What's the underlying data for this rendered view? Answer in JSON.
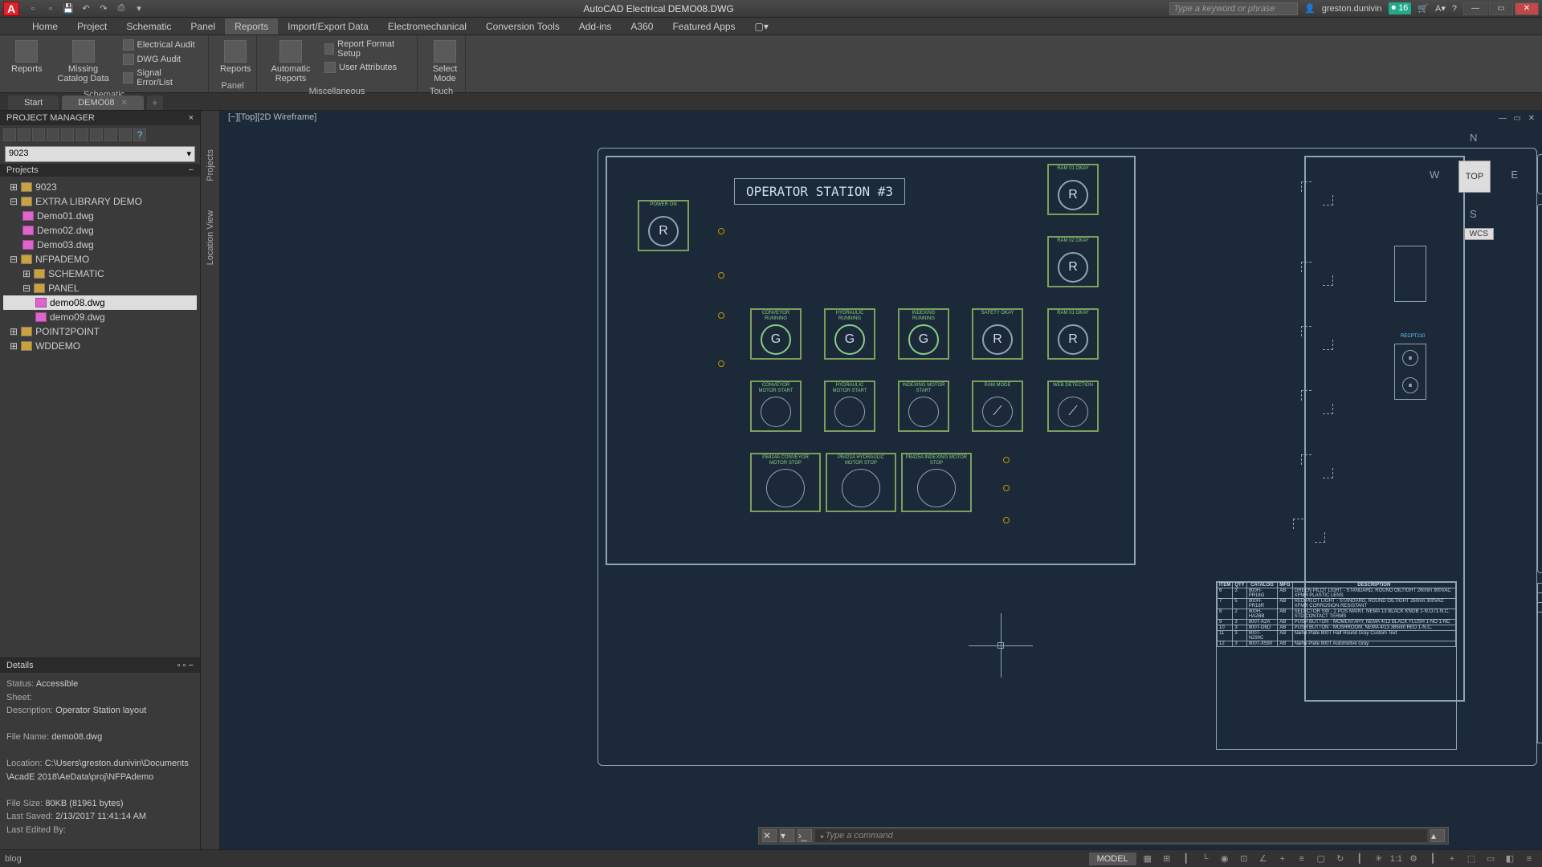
{
  "title": "AutoCAD Electrical   DEMO08.DWG",
  "search_placeholder": "Type a keyword or phrase",
  "user": "greston.dunivin",
  "info_badge": "16",
  "menu": [
    "Home",
    "Project",
    "Schematic",
    "Panel",
    "Reports",
    "Import/Export Data",
    "Electromechanical",
    "Conversion Tools",
    "Add-ins",
    "A360",
    "Featured Apps"
  ],
  "active_menu": "Reports",
  "ribbon": {
    "schematic": {
      "title": "Schematic",
      "reports": "Reports",
      "missing": "Missing Catalog Data",
      "audit": "Electrical Audit",
      "dwg_audit": "DWG Audit",
      "signal": "Signal Error/List"
    },
    "panel": {
      "title": "Panel",
      "reports": "Reports"
    },
    "misc": {
      "title": "Miscellaneous",
      "auto": "Automatic Reports",
      "format": "Report Format Setup",
      "user_attr": "User Attributes"
    },
    "touch": {
      "title": "Touch",
      "select": "Select Mode"
    }
  },
  "tabs": {
    "start": "Start",
    "file": "DEMO08"
  },
  "project_panel": {
    "title": "PROJECT MANAGER",
    "dropdown": "9023",
    "projects_label": "Projects",
    "tree": {
      "p1": "9023",
      "p2": "EXTRA LIBRARY DEMO",
      "p2a": "Demo01.dwg",
      "p2b": "Demo02.dwg",
      "p2c": "Demo03.dwg",
      "p3": "NFPADEMO",
      "p3a": "SCHEMATIC",
      "p3b": "PANEL",
      "p3b1": "demo08.dwg",
      "p3b2": "demo09.dwg",
      "p4": "POINT2POINT",
      "p5": "WDDEMO"
    }
  },
  "side_tabs": {
    "projects": "Projects",
    "location": "Location View"
  },
  "details": {
    "title": "Details",
    "status_l": "Status:",
    "status_v": "Accessible",
    "sheet_l": "Sheet:",
    "desc_l": "Description:",
    "desc_v": "Operator Station layout",
    "fname_l": "File Name:",
    "fname_v": "demo08.dwg",
    "loc_l": "Location:",
    "loc_v": "C:\\Users\\greston.dunivin\\Documents\\AcadE 2018\\AeData\\proj\\NFPAdemo",
    "size_l": "File Size:",
    "size_v": "80KB (81961 bytes)",
    "saved_l": "Last Saved:",
    "saved_v": "2/13/2017 11:41:14 AM",
    "edited_l": "Last Edited By:"
  },
  "view_label": "[−][Top][2D Wireframe]",
  "station_title": "OPERATOR STATION #3",
  "viewcube": {
    "top": "TOP",
    "n": "N",
    "s": "S",
    "e": "E",
    "w": "W",
    "wcs": "WCS"
  },
  "components": {
    "power_on": "POWER ON",
    "ram01": "RAM 01 OKAY",
    "ram02": "RAM 02 OKAY",
    "conv_run": "CONVEYOR RUNNING",
    "hyd_run": "HYDRAULIC RUNNING",
    "idx_run": "INDEXING RUNNING",
    "safety": "SAFETY OKAY",
    "ram01_b": "RAM 01 OKAY",
    "conv_start": "CONVEYOR MOTOR START",
    "hyd_start": "HYDRAULIC MOTOR START",
    "idx_start": "INDEXING MOTOR START",
    "ram_mode": "RAM MODE",
    "web_det": "WEB DETECTION",
    "pb414a": "PB414A CONVEYOR MOTOR STOP",
    "pb422a": "PB422A HYDRAULIC MOTOR STOP",
    "pb425a": "PB425A INDEXING MOTOR STOP",
    "recpt": "RECPT210"
  },
  "bom": {
    "headers": [
      "ITEM",
      "QTY",
      "CATALOG",
      "MFG",
      "DESCRIPTION"
    ],
    "rows": [
      [
        "6",
        "3",
        "800H-PR16G",
        "AB",
        "GREEN PILOT LIGHT - STANDARD, ROUND OILTIGHT 260nm 300VAC XFMR PLASTIC LENS"
      ],
      [
        "7",
        "5",
        "800H-PR16R",
        "AB",
        "RED PILOT LIGHT - STANDARD, ROUND OILTIGHT 260nm 300VAC XFMR CORROSION RESISTANT"
      ],
      [
        "8",
        "2",
        "800H-HA2BB",
        "AB",
        "SELECTOR SW - 2 POS MAINT. NEMA 13 BLACK KNOB 1-N.O./1-N.C. STD CONTACT TERMS"
      ],
      [
        "9",
        "3",
        "800T-A2A",
        "AB",
        "PUSH BUTTON - MOMENTARY, NEMA 4/13 BLACK FLUSH 1-NO 1-NC"
      ],
      [
        "10",
        "3",
        "800T-D6D",
        "AB",
        "PUSH BUTTON - MUSHROOM, NEMA 4/13 365nm RED 1-N.C."
      ],
      [
        "11",
        "3",
        "800T-N290C",
        "AB",
        "Name Plate 800T Half Round Gray Custom Text"
      ],
      [
        "12",
        "3",
        "800T-X590",
        "AB",
        "Name Plate 800T Automotive Gray"
      ]
    ]
  },
  "cmd_placeholder": "Type a command",
  "status": {
    "blog": "blog",
    "model": "MODEL",
    "scale": "1:1"
  }
}
